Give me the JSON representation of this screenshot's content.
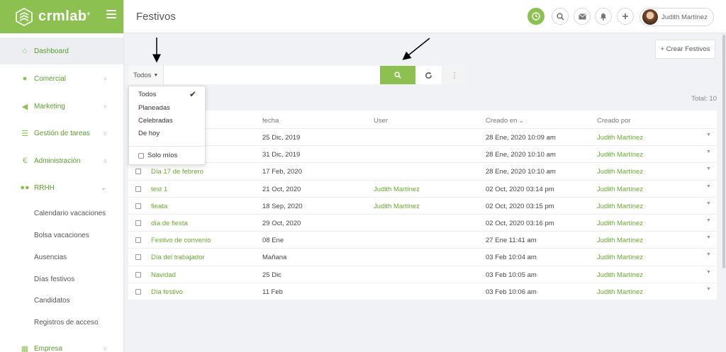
{
  "app": {
    "logo": "crmlab",
    "logo_sup": "®"
  },
  "sidebar": {
    "items": [
      {
        "label": "Dashboard",
        "icon": "home-icon"
      },
      {
        "label": "Comercial",
        "icon": "user-icon"
      },
      {
        "label": "Marketing",
        "icon": "megaphone-icon"
      },
      {
        "label": "Gestión de tareas",
        "icon": "list-icon"
      },
      {
        "label": "Administración",
        "icon": "euro-icon"
      },
      {
        "label": "RRHH",
        "icon": "users-icon"
      },
      {
        "label": "Empresa",
        "icon": "building-icon"
      }
    ],
    "sub_items": [
      {
        "label": "Calendario vacaciones"
      },
      {
        "label": "Bolsa vacaciones"
      },
      {
        "label": "Ausencias"
      },
      {
        "label": "Días festivos"
      },
      {
        "label": "Candidatos"
      },
      {
        "label": "Registros de acceso"
      }
    ]
  },
  "header": {
    "title": "Festivos",
    "user_name": "Judith Martínez"
  },
  "actions": {
    "create_label": "+ Crear Festivos"
  },
  "filter": {
    "selected": "Todos",
    "options": [
      "Todos",
      "Planeadas",
      "Celebradas",
      "De hoy"
    ],
    "only_mine_label": "Solo míos"
  },
  "total_label": "Total: 10",
  "table": {
    "columns": [
      "fecha",
      "User",
      "Creado en",
      "Creado por"
    ],
    "rows": [
      {
        "name": "",
        "fecha": "25 Dic, 2019",
        "user": "",
        "creado_en": "28 Ene, 2020 10:09 am",
        "creado_por": "Judith Martínez"
      },
      {
        "name": "",
        "fecha": "31 Dic, 2019",
        "user": "",
        "creado_en": "28 Ene, 2020 10:10 am",
        "creado_por": "Judith Martínez"
      },
      {
        "name": "Día 17 de febrero",
        "fecha": "17 Feb, 2020",
        "user": "",
        "creado_en": "28 Ene, 2020 10:10 am",
        "creado_por": "Judith Martínez"
      },
      {
        "name": "test 1",
        "fecha": "21 Oct, 2020",
        "user": "Judith Martínez",
        "creado_en": "02 Oct, 2020 03:14 pm",
        "creado_por": "Judith Martínez"
      },
      {
        "name": "fieata",
        "fecha": "18 Sep, 2020",
        "user": "Judith Martínez",
        "creado_en": "02 Oct, 2020 03:15 pm",
        "creado_por": "Judith Martínez"
      },
      {
        "name": "día de fiesta",
        "fecha": "29 Oct, 2020",
        "user": "",
        "creado_en": "02 Oct, 2020 03:16 pm",
        "creado_por": "Judith Martínez"
      },
      {
        "name": "Festivo de convenio",
        "fecha": "08 Ene",
        "user": "",
        "creado_en": "27 Ene 11:41 am",
        "creado_por": "Judith Martínez"
      },
      {
        "name": "Día del trabajador",
        "fecha": "Mañana",
        "user": "",
        "creado_en": "03 Feb 10:04 am",
        "creado_por": "Judith Martínez"
      },
      {
        "name": "Navidad",
        "fecha": "25 Dic",
        "user": "",
        "creado_en": "03 Feb 10:05 am",
        "creado_por": "Judith Martínez"
      },
      {
        "name": "Día festivo",
        "fecha": "11 Feb",
        "user": "",
        "creado_en": "03 Feb 10:06 am",
        "creado_por": "Judith Martínez"
      }
    ]
  },
  "colors": {
    "brand": "#8cc152",
    "link": "#6aaa32"
  }
}
